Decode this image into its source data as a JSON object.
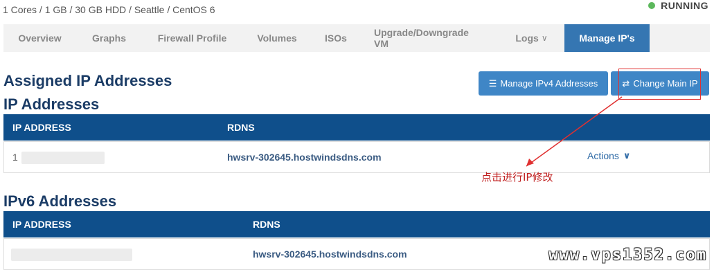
{
  "header": {
    "server_info": "1 Cores / 1 GB / 30 GB HDD / Seattle / CentOS 6",
    "status": "RUNNING",
    "status_color": "#5cb85c"
  },
  "tabs": [
    {
      "label": "Overview"
    },
    {
      "label": "Graphs"
    },
    {
      "label": "Firewall Profile"
    },
    {
      "label": "Volumes"
    },
    {
      "label": "ISOs"
    },
    {
      "label": "Upgrade/Downgrade VM"
    },
    {
      "label": "Logs"
    },
    {
      "label": "Manage IP's"
    }
  ],
  "active_tab": "Manage IP's",
  "assigned": {
    "title": "Assigned IP Addresses",
    "manage_ipv4_label": "Manage IPv4 Addresses",
    "change_main_ip_label": "Change Main IP"
  },
  "ipv4": {
    "title": "IP Addresses",
    "columns": [
      "IP ADDRESS",
      "RDNS"
    ],
    "rows": [
      {
        "ip": "1",
        "rdns": "hwsrv-302645.hostwindsdns.com",
        "action": "Actions"
      }
    ]
  },
  "ipv6": {
    "title": "IPv6 Addresses",
    "columns": [
      "IP ADDRESS",
      "RDNS"
    ],
    "rows": [
      {
        "ip": "",
        "rdns": "hwsrv-302645.hostwindsdns.com"
      }
    ]
  },
  "annotation": "点击进行IP修改",
  "watermark": "www.vps1352.com",
  "colors": {
    "accent": "#3576b2",
    "button": "#3f86c6",
    "table_header": "#0f4f8b",
    "heading": "#1b3c66",
    "annotation": "#c02020"
  }
}
